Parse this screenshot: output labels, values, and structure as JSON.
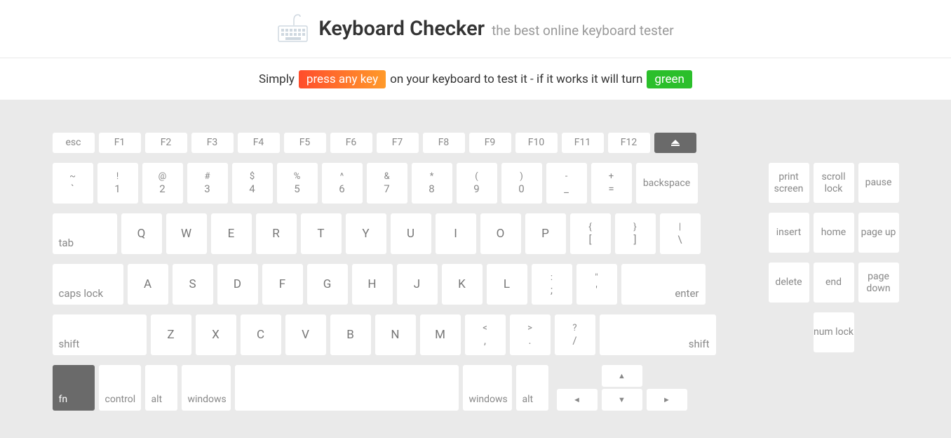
{
  "header": {
    "title": "Keyboard Checker",
    "subtitle": "the best online keyboard tester"
  },
  "instructions": {
    "prefix": "Simply",
    "press_badge": "press any key",
    "middle": "on your keyboard to test it - if it works it will turn",
    "green_badge": "green"
  },
  "keys": {
    "esc": "esc",
    "f1": "F1",
    "f2": "F2",
    "f3": "F3",
    "f4": "F4",
    "f5": "F5",
    "f6": "F6",
    "f7": "F7",
    "f8": "F8",
    "f9": "F9",
    "f10": "F10",
    "f11": "F11",
    "f12": "F12",
    "tilde_top": "~",
    "tilde_bot": "`",
    "n1_top": "!",
    "n1_bot": "1",
    "n2_top": "@",
    "n2_bot": "2",
    "n3_top": "#",
    "n3_bot": "3",
    "n4_top": "$",
    "n4_bot": "4",
    "n5_top": "%",
    "n5_bot": "5",
    "n6_top": "^",
    "n6_bot": "6",
    "n7_top": "&",
    "n7_bot": "7",
    "n8_top": "*",
    "n8_bot": "8",
    "n9_top": "(",
    "n9_bot": "9",
    "n0_top": ")",
    "n0_bot": "0",
    "dash_top": "-",
    "dash_bot": "_",
    "eq_top": "+",
    "eq_bot": "=",
    "backspace": "backspace",
    "tab": "tab",
    "q": "Q",
    "w": "W",
    "e": "E",
    "r": "R",
    "t": "T",
    "y": "Y",
    "u": "U",
    "i": "I",
    "o": "O",
    "p": "P",
    "lb_top": "{",
    "lb_bot": "[",
    "rb_top": "}",
    "rb_bot": "]",
    "bs_top": "|",
    "bs_bot": "\\",
    "caps": "caps lock",
    "a": "A",
    "s": "S",
    "d": "D",
    "f": "F",
    "g": "G",
    "h": "H",
    "j": "J",
    "k": "K",
    "l": "L",
    "sc_top": ":",
    "sc_bot": ";",
    "qt_top": "\"",
    "qt_bot": "'",
    "enter": "enter",
    "shift": "shift",
    "z": "Z",
    "x": "X",
    "c": "C",
    "v": "V",
    "b": "B",
    "n": "N",
    "m": "M",
    "cm_top": "<",
    "cm_bot": ",",
    "pd_top": ">",
    "pd_bot": ".",
    "sl_top": "?",
    "sl_bot": "/",
    "fn": "fn",
    "ctrl": "control",
    "alt": "alt",
    "win": "windows",
    "up": "▲",
    "down": "▼",
    "left": "◄",
    "right": "►",
    "print": "print screen",
    "scroll": "scroll lock",
    "pause": "pause",
    "insert": "insert",
    "home": "home",
    "pgup": "page up",
    "delete": "delete",
    "end": "end",
    "pgdn": "page down",
    "num": "num lock"
  }
}
